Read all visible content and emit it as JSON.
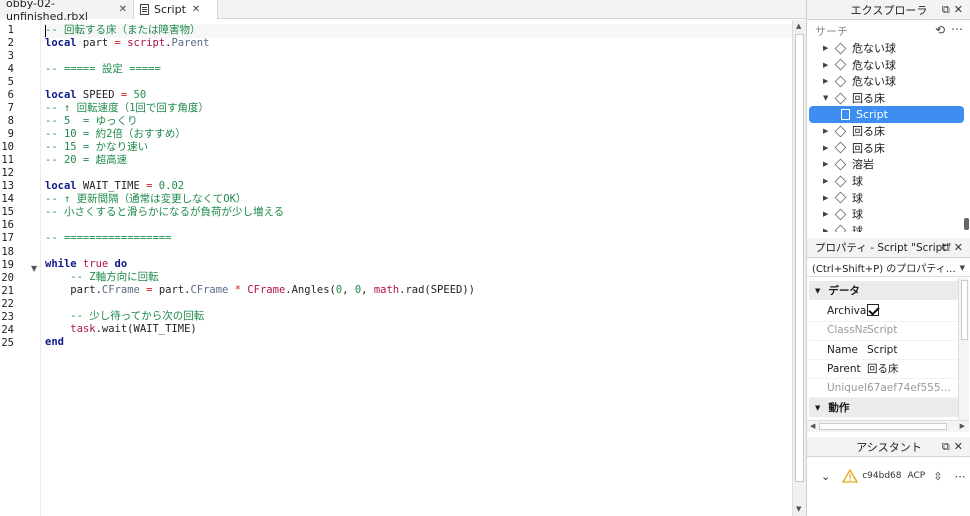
{
  "tabs": [
    {
      "label": "obby-02-unfinished.rbxl",
      "close": "✕"
    },
    {
      "label": "Script",
      "close": "✕"
    }
  ],
  "editor": {
    "line_numbers": [
      "1",
      "2",
      "3",
      "4",
      "5",
      "6",
      "7",
      "8",
      "9",
      "10",
      "11",
      "12",
      "13",
      "14",
      "15",
      "16",
      "17",
      "18",
      "19",
      "20",
      "21",
      "22",
      "23",
      "24",
      "25"
    ],
    "code": [
      [
        {
          "t": "-- 回転する床（または障害物）",
          "c": "cm"
        }
      ],
      [
        {
          "t": "local",
          "c": "kw"
        },
        {
          "t": " part ",
          "c": "pl"
        },
        {
          "t": "=",
          "c": "op"
        },
        {
          "t": " script",
          "c": "bi"
        },
        {
          "t": ".",
          "c": "pl"
        },
        {
          "t": "Parent",
          "c": "prop"
        }
      ],
      [],
      [
        {
          "t": "-- ===== 設定 =====",
          "c": "cm"
        }
      ],
      [],
      [
        {
          "t": "local",
          "c": "kw"
        },
        {
          "t": " SPEED ",
          "c": "pl"
        },
        {
          "t": "=",
          "c": "op"
        },
        {
          "t": " 50",
          "c": "num"
        }
      ],
      [
        {
          "t": "-- ↑ 回転速度（1回で回す角度）",
          "c": "cm"
        }
      ],
      [
        {
          "t": "-- 5  = ゆっくり",
          "c": "cm"
        }
      ],
      [
        {
          "t": "-- 10 = 約2倍（おすすめ）",
          "c": "cm"
        }
      ],
      [
        {
          "t": "-- 15 = かなり速い",
          "c": "cm"
        }
      ],
      [
        {
          "t": "-- 20 = 超高速",
          "c": "cm"
        }
      ],
      [],
      [
        {
          "t": "local",
          "c": "kw"
        },
        {
          "t": " WAIT_TIME ",
          "c": "pl"
        },
        {
          "t": "=",
          "c": "op"
        },
        {
          "t": " 0.02",
          "c": "num"
        }
      ],
      [
        {
          "t": "-- ↑ 更新間隔（通常は変更しなくてOK）",
          "c": "cm"
        }
      ],
      [
        {
          "t": "-- 小さくすると滑らかになるが負荷が少し増える",
          "c": "cm"
        }
      ],
      [],
      [
        {
          "t": "-- =================",
          "c": "cm"
        }
      ],
      [],
      [
        {
          "t": "while",
          "c": "kw"
        },
        {
          "t": " true",
          "c": "bi"
        },
        {
          "t": " do",
          "c": "kw"
        }
      ],
      [
        {
          "t": "    -- Z軸方向に回転",
          "c": "cm"
        }
      ],
      [
        {
          "t": "    part",
          "c": "pl"
        },
        {
          "t": ".",
          "c": "pl"
        },
        {
          "t": "CFrame",
          "c": "prop"
        },
        {
          "t": " = ",
          "c": "op"
        },
        {
          "t": "part",
          "c": "pl"
        },
        {
          "t": ".",
          "c": "pl"
        },
        {
          "t": "CFrame",
          "c": "prop"
        },
        {
          "t": " * ",
          "c": "op"
        },
        {
          "t": "CFrame",
          "c": "bi"
        },
        {
          "t": ".Angles(",
          "c": "pl"
        },
        {
          "t": "0",
          "c": "num"
        },
        {
          "t": ", ",
          "c": "pl"
        },
        {
          "t": "0",
          "c": "num"
        },
        {
          "t": ", ",
          "c": "pl"
        },
        {
          "t": "math",
          "c": "bi"
        },
        {
          "t": ".rad(SPEED))",
          "c": "pl"
        }
      ],
      [],
      [
        {
          "t": "    -- 少し待ってから次の回転",
          "c": "cm"
        }
      ],
      [
        {
          "t": "    task",
          "c": "bi"
        },
        {
          "t": ".wait(WAIT_TIME)",
          "c": "pl"
        }
      ],
      [
        {
          "t": "end",
          "c": "kw"
        }
      ]
    ]
  },
  "explorer": {
    "title": "エクスプローラ",
    "search_placeholder": "サーチ",
    "items": [
      {
        "label": "危ない球",
        "type": "part",
        "arrow": "▶"
      },
      {
        "label": "危ない球",
        "type": "part",
        "arrow": "▶"
      },
      {
        "label": "危ない球",
        "type": "part",
        "arrow": "▶"
      },
      {
        "label": "回る床",
        "type": "part",
        "arrow": "▼"
      },
      {
        "label": "Script",
        "type": "script",
        "selected": true
      },
      {
        "label": "回る床",
        "type": "part",
        "arrow": "▶"
      },
      {
        "label": "回る床",
        "type": "part",
        "arrow": "▶"
      },
      {
        "label": "溶岩",
        "type": "part",
        "arrow": "▶"
      },
      {
        "label": "球",
        "type": "part",
        "arrow": "▶"
      },
      {
        "label": "球",
        "type": "part",
        "arrow": "▶"
      },
      {
        "label": "球",
        "type": "part",
        "arrow": "▶"
      },
      {
        "label": "球",
        "type": "part",
        "arrow": "▶"
      }
    ]
  },
  "properties": {
    "title": "プロパティ - Script \"Script\"",
    "filter": "(Ctrl+Shift+P) のプロパティ…",
    "sections": {
      "data": "データ",
      "behavior": "動作"
    },
    "rows": [
      {
        "key": "Archivable",
        "value": "",
        "checkbox": true
      },
      {
        "key": "ClassNa…",
        "value": "Script",
        "dim": true
      },
      {
        "key": "Name",
        "value": "Script"
      },
      {
        "key": "Parent",
        "value": "回る床"
      },
      {
        "key": "UniqueId",
        "value": "67aef74ef555…",
        "dim": true
      }
    ]
  },
  "assistant": {
    "title": "アシスタント",
    "session_id": "c94bd68",
    "protocol": "ACP"
  },
  "colors": {
    "selection": "#3d8ef0",
    "comment": "#1f8a4c",
    "keyword": "#0c1a8c",
    "builtin": "#b0124c",
    "warning": "#e6a817"
  }
}
